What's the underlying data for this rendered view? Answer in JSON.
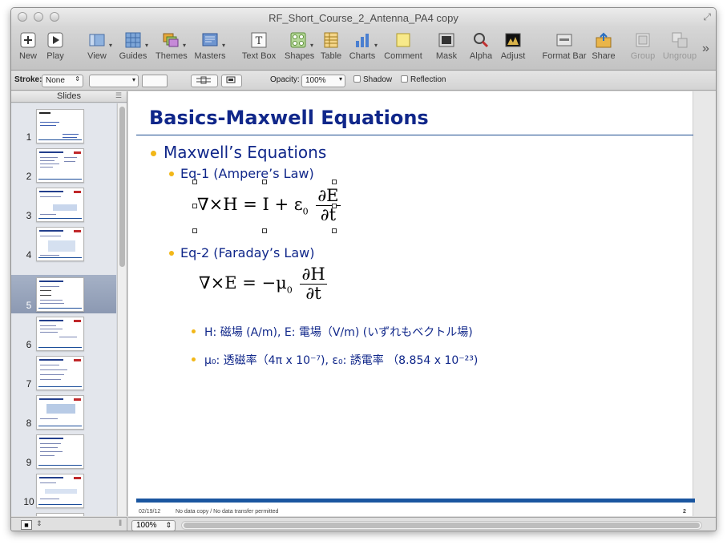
{
  "window": {
    "title": "RF_Short_Course_2_Antenna_PA4 copy"
  },
  "toolbar": {
    "items": [
      {
        "label": "New",
        "icon": "plus-icon"
      },
      {
        "label": "Play",
        "icon": "play-icon"
      },
      {
        "label": "View",
        "icon": "view-icon"
      },
      {
        "label": "Guides",
        "icon": "grid-icon"
      },
      {
        "label": "Themes",
        "icon": "themes-icon"
      },
      {
        "label": "Masters",
        "icon": "masters-icon"
      },
      {
        "label": "Text Box",
        "icon": "text-box-icon"
      },
      {
        "label": "Shapes",
        "icon": "shapes-icon"
      },
      {
        "label": "Table",
        "icon": "table-icon"
      },
      {
        "label": "Charts",
        "icon": "chart-icon"
      },
      {
        "label": "Comment",
        "icon": "comment-icon"
      },
      {
        "label": "Mask",
        "icon": "mask-icon"
      },
      {
        "label": "Alpha",
        "icon": "alpha-icon"
      },
      {
        "label": "Adjust",
        "icon": "adjust-icon"
      },
      {
        "label": "Format Bar",
        "icon": "format-bar-icon"
      },
      {
        "label": "Share",
        "icon": "share-icon"
      },
      {
        "label": "Group",
        "icon": "group-icon"
      },
      {
        "label": "Ungroup",
        "icon": "ungroup-icon"
      }
    ],
    "overflow": "»"
  },
  "formatbar": {
    "stroke_label": "Stroke:",
    "stroke_value": "None",
    "opacity_label": "Opacity:",
    "opacity_value": "100%",
    "shadow_label": "Shadow",
    "reflection_label": "Reflection"
  },
  "sidebar": {
    "title": "Slides",
    "slides": [
      "1",
      "2",
      "3",
      "4",
      "5",
      "6",
      "7",
      "8",
      "9",
      "10"
    ],
    "selected": "5"
  },
  "slide": {
    "title": "Basics-Maxwell Equations",
    "bullet1": "Maxwell’s Equations",
    "eq1_label": "Eq-1 (Ampere’s Law)",
    "eq1_lhs": "∇×H = I + ε",
    "eq1_sub": "0",
    "eq1_num": "∂E",
    "eq1_den": "∂t",
    "eq2_label": "Eq-2 (Faraday’s Law)",
    "eq2_lhs": "∇×E = −μ",
    "eq2_sub": "0",
    "eq2_num": "∂H",
    "eq2_den": "∂t",
    "note1": "H: 磁場 (A/m), E: 電場（V/m) (いずれもベクトル場)",
    "note2": "μ₀: 透磁率（4π x 10⁻⁷), ε₀: 誘電率 （8.854 x 10⁻²³)",
    "footer_date": "02/19/12",
    "footer_note": "No data copy / No data transfer permitted",
    "page_number": "2"
  },
  "status": {
    "zoom": "100%"
  },
  "colors": {
    "title": "#10278a",
    "bullet": "#f2b718",
    "footer_bar": "#1a56a0"
  }
}
